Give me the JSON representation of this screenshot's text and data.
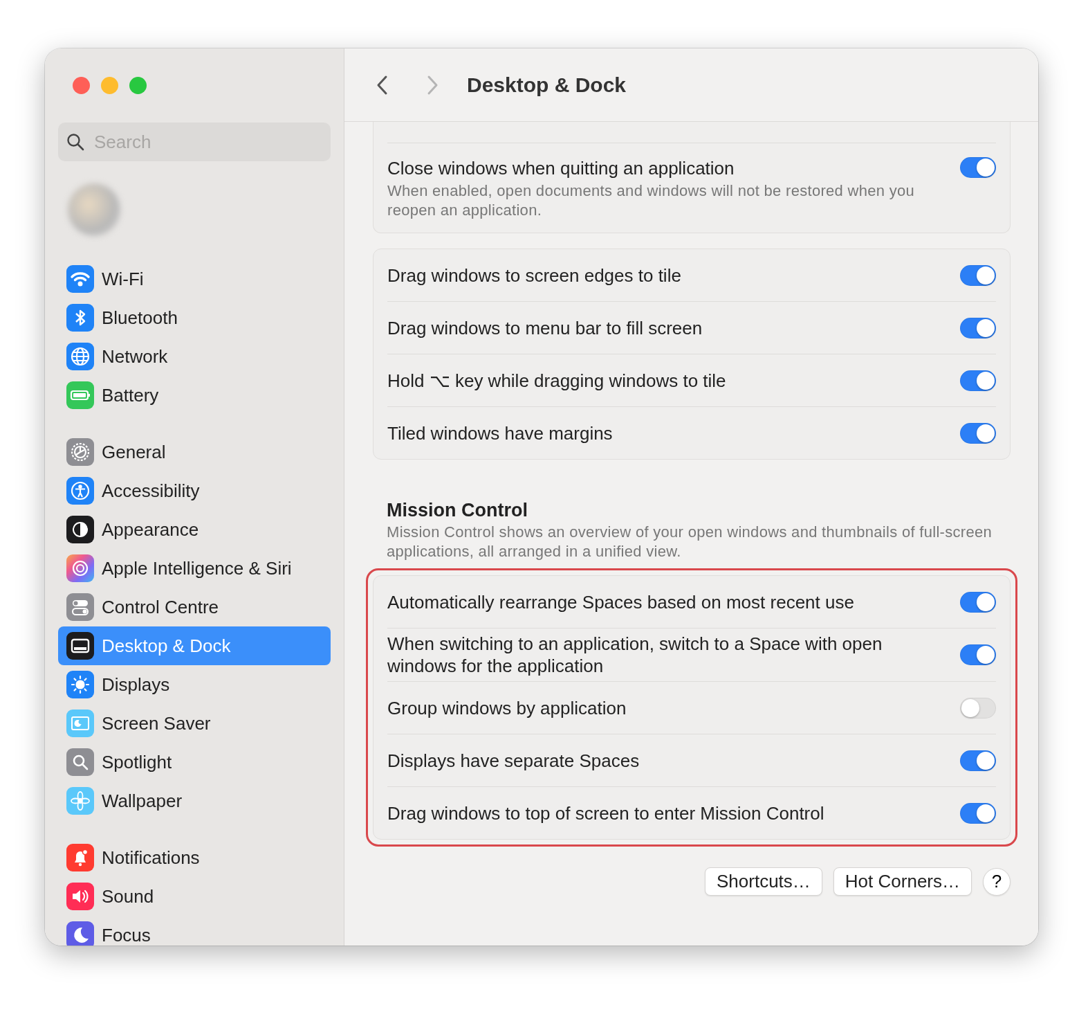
{
  "window": {
    "title": "Desktop & Dock"
  },
  "sidebar": {
    "search": {
      "placeholder": "Search"
    },
    "groups": [
      [
        {
          "label": "Wi-Fi",
          "selected": false
        },
        {
          "label": "Bluetooth",
          "selected": false
        },
        {
          "label": "Network",
          "selected": false
        },
        {
          "label": "Battery",
          "selected": false
        }
      ],
      [
        {
          "label": "General",
          "selected": false
        },
        {
          "label": "Accessibility",
          "selected": false
        },
        {
          "label": "Appearance",
          "selected": false
        },
        {
          "label": "Apple Intelligence & Siri",
          "selected": false
        },
        {
          "label": "Control Centre",
          "selected": false
        },
        {
          "label": "Desktop & Dock",
          "selected": true
        },
        {
          "label": "Displays",
          "selected": false
        },
        {
          "label": "Screen Saver",
          "selected": false
        },
        {
          "label": "Spotlight",
          "selected": false
        },
        {
          "label": "Wallpaper",
          "selected": false
        }
      ],
      [
        {
          "label": "Notifications",
          "selected": false
        },
        {
          "label": "Sound",
          "selected": false
        },
        {
          "label": "Focus",
          "selected": false
        }
      ]
    ]
  },
  "sections": [
    {
      "highlighted": false,
      "cut_top": true,
      "rows": [
        {
          "label": "Close windows when quitting an application",
          "description": "When enabled, open documents and windows will not be restored when you reopen an application.",
          "on": true
        }
      ]
    },
    {
      "highlighted": false,
      "cut_top": false,
      "rows": [
        {
          "label": "Drag windows to screen edges to tile",
          "on": true
        },
        {
          "label": "Drag windows to menu bar to fill screen",
          "on": true
        },
        {
          "label": "Hold ⌥ key while dragging windows to tile",
          "on": true
        },
        {
          "label": "Tiled windows have margins",
          "on": true
        }
      ]
    },
    {
      "heading": "Mission Control",
      "description": "Mission Control shows an overview of your open windows and thumbnails of full-screen applications, all arranged in a unified view.",
      "highlighted": true,
      "cut_top": false,
      "rows": [
        {
          "label": "Automatically rearrange Spaces based on most recent use",
          "on": true
        },
        {
          "label": "When switching to an application, switch to a Space with open windows for the application",
          "on": true
        },
        {
          "label": "Group windows by application",
          "on": false
        },
        {
          "label": "Displays have separate Spaces",
          "on": true
        },
        {
          "label": "Drag windows to top of screen to enter Mission Control",
          "on": true
        }
      ]
    }
  ],
  "buttons": [
    "Shortcuts…",
    "Hot Corners…",
    "?"
  ]
}
